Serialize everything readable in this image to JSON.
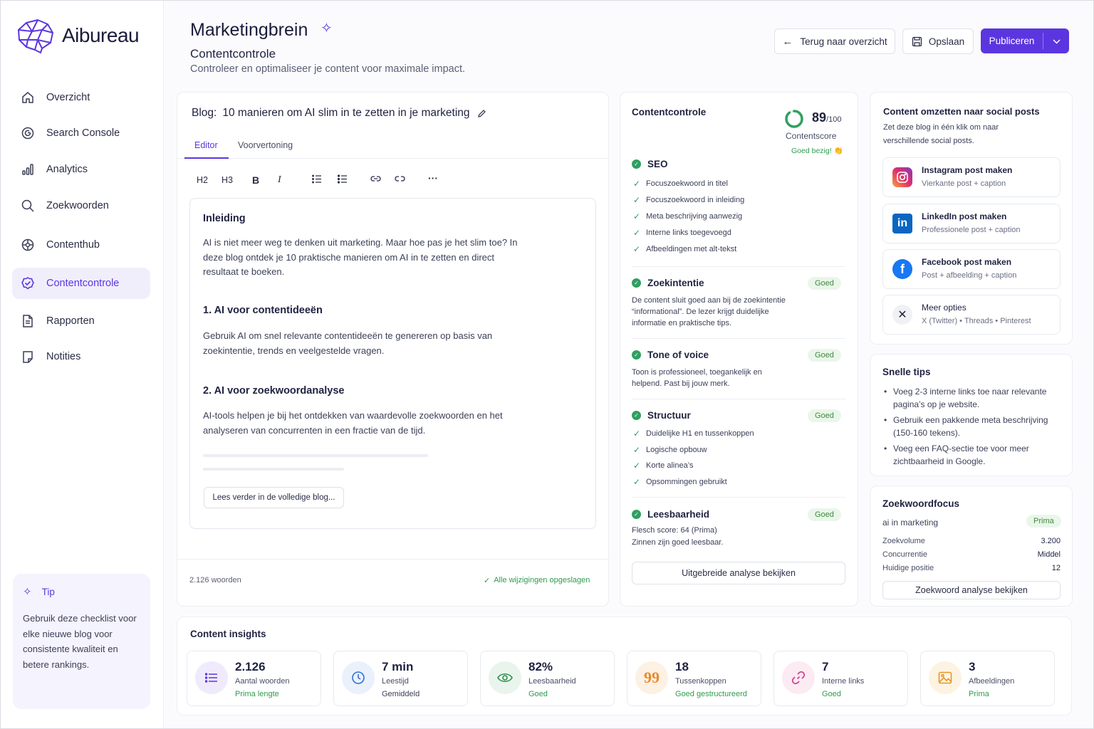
{
  "brand": {
    "name": "Aibureau"
  },
  "nav": {
    "items": [
      {
        "label": "Overzicht",
        "icon": "home-icon"
      },
      {
        "label": "Search Console",
        "icon": "google-icon"
      },
      {
        "label": "Analytics",
        "icon": "bar-chart-icon"
      },
      {
        "label": "Zoekwoorden",
        "icon": "search-icon"
      },
      {
        "label": "Contenthub",
        "icon": "hub-icon"
      },
      {
        "label": "Contentcontrole",
        "icon": "check-badge-icon"
      },
      {
        "label": "Rapporten",
        "icon": "document-icon"
      },
      {
        "label": "Notities",
        "icon": "note-icon"
      }
    ],
    "active": "Contentcontrole"
  },
  "tip": {
    "title": "Tip",
    "text": "Gebruik deze checklist voor elke nieuwe blog voor consistente kwaliteit en betere rankings."
  },
  "header": {
    "title": "Marketingbrein",
    "subtitle": "Contentcontrole",
    "description": "Controleer en optimaliseer je content voor maximale impact.",
    "back_label": "Terug naar overzicht",
    "save_label": "Opslaan",
    "publish_label": "Publiceren"
  },
  "accent": "#5b36e0",
  "editor": {
    "blog_prefix": "Blog:",
    "blog_title": "10 manieren om AI slim in te zetten in je marketing",
    "tabs": [
      "Editor",
      "Voorvertoning"
    ],
    "toolbar": {
      "h2": "H2",
      "h3": "H3",
      "bold": "B",
      "italic": "I",
      "more": "···"
    },
    "h_intro": "Inleiding",
    "p_intro": "AI is niet meer weg te denken uit marketing. Maar hoe pas je het slim toe? In deze blog ontdek je 10 praktische manieren om AI in te zetten en direct resultaat te boeken.",
    "h1": "1. AI voor contentideeën",
    "p1": "Gebruik AI om snel relevante contentideeën te genereren op basis van zoekintentie, trends en veelgestelde vragen.",
    "h2": "2. AI voor zoekwoordanalyse",
    "p2": "AI-tools helpen je bij het ontdekken van waardevolle zoekwoorden en het analyseren van concurrenten in een fractie van de tijd.",
    "read_more": "Lees verder in de volledige blog...",
    "word_count": "2.126 woorden",
    "saved": "Alle wijzigingen opgeslagen"
  },
  "check": {
    "title": "Contentcontrole",
    "score": "89",
    "score_max": "/100",
    "score_label": "Contentscore",
    "score_note": "Goed bezig! 👏",
    "score_progress": 0.89,
    "seo_title": "SEO",
    "seo_items": [
      "Focuszoekwoord in titel",
      "Focuszoekwoord in inleiding",
      "Meta beschrijving aanwezig",
      "Interne links toegevoegd",
      "Afbeeldingen met alt-tekst"
    ],
    "intent_title": "Zoekintentie",
    "intent_badge": "Goed",
    "intent_text": "De content sluit goed aan bij de zoekintentie “informational”. De lezer krijgt duidelijke informatie en praktische tips.",
    "tone_title": "Tone of voice",
    "tone_badge": "Goed",
    "tone_text": "Toon is professioneel, toegankelijk en helpend. Past bij jouw merk.",
    "struct_title": "Structuur",
    "struct_badge": "Goed",
    "struct_items": [
      "Duidelijke H1 en tussenkoppen",
      "Logische opbouw",
      "Korte alinea’s",
      "Opsommingen gebruikt"
    ],
    "read_title": "Leesbaarheid",
    "read_badge": "Goed",
    "read_line1": "Flesch score: 64 (Prima)",
    "read_line2": "Zinnen zijn goed leesbaar.",
    "analysis_button": "Uitgebreide analyse bekijken"
  },
  "social": {
    "title": "Content omzetten naar social posts",
    "desc": "Zet deze blog in één klik om naar verschillende social posts.",
    "items": [
      {
        "title": "Instagram post maken",
        "sub": "Vierkante post + caption",
        "icon": "instagram-icon"
      },
      {
        "title": "LinkedIn post maken",
        "sub": "Professionele post + caption",
        "icon": "linkedin-icon"
      },
      {
        "title": "Facebook post maken",
        "sub": "Post + afbeelding + caption",
        "icon": "facebook-icon"
      },
      {
        "title": "Meer opties",
        "sub": "X (Twitter) • Threads • Pinterest",
        "icon": "x-icon"
      }
    ]
  },
  "tips": {
    "title": "Snelle tips",
    "items": [
      "Voeg 2-3 interne links toe naar relevante pagina’s op je website.",
      "Gebruik een pakkende meta beschrijving (150-160 tekens).",
      "Voeg een FAQ-sectie toe voor meer zichtbaarheid in Google."
    ]
  },
  "keyword": {
    "title": "Zoekwoordfocus",
    "term": "ai in marketing",
    "badge": "Prima",
    "rows": [
      {
        "label": "Zoekvolume",
        "value": "3.200"
      },
      {
        "label": "Concurrentie",
        "value": "Middel"
      },
      {
        "label": "Huidige positie",
        "value": "12"
      }
    ],
    "button": "Zoekwoord analyse bekijken"
  },
  "insights": {
    "title": "Content insights",
    "items": [
      {
        "value": "2.126",
        "label": "Aantal woorden",
        "sub": "Prima lengte",
        "icon": "list-icon"
      },
      {
        "value": "7 min",
        "label": "Leestijd",
        "sub": "Gemiddeld",
        "icon": "clock-icon"
      },
      {
        "value": "82%",
        "label": "Leesbaarheid",
        "sub": "Goed",
        "icon": "eye-icon"
      },
      {
        "value": "18",
        "label": "Tussenkoppen",
        "sub": "Goed gestructureerd",
        "icon": "quote-icon"
      },
      {
        "value": "7",
        "label": "Interne links",
        "sub": "Goed",
        "icon": "link-icon"
      },
      {
        "value": "3",
        "label": "Afbeeldingen",
        "sub": "Prima",
        "icon": "image-icon"
      }
    ]
  }
}
